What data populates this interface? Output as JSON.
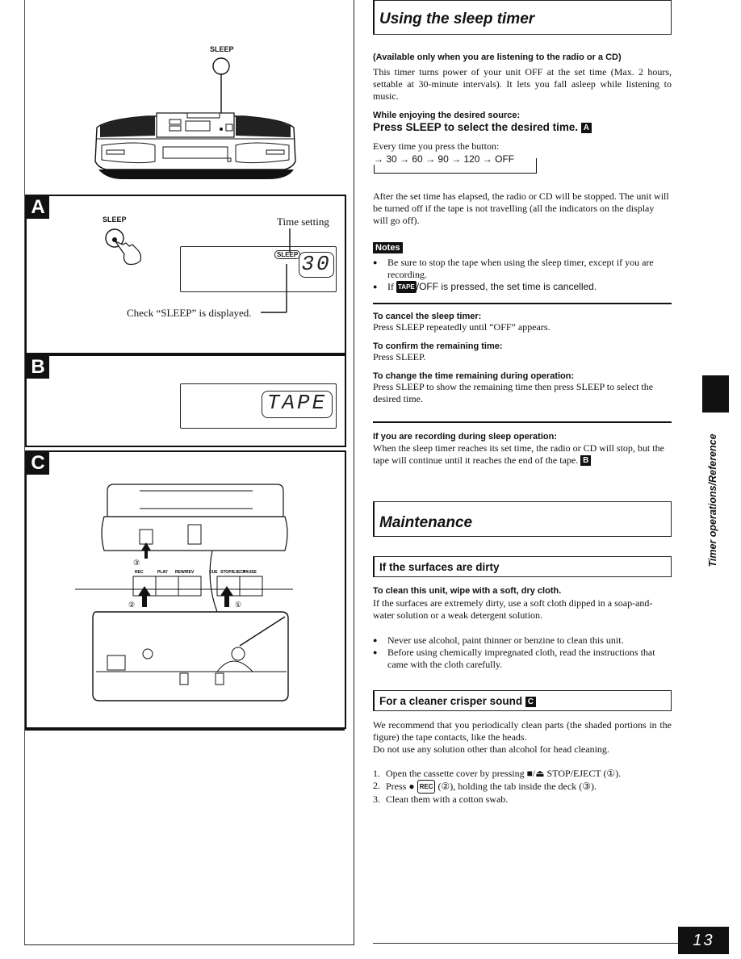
{
  "left": {
    "top_figure": {
      "button_label": "SLEEP"
    },
    "panel_a": {
      "letter": "A",
      "button_label": "SLEEP",
      "time_setting_label": "Time setting",
      "lcd_tag": "SLEEP",
      "lcd_digits": "30",
      "check_label": "Check “SLEEP” is displayed."
    },
    "panel_b": {
      "letter": "B",
      "lcd_text": "TAPE"
    },
    "panel_c": {
      "letter": "C",
      "button_labels": [
        "REC",
        "PLAY",
        "REW/REV",
        "CUE",
        "STOP/EJECT",
        "PAUSE"
      ],
      "callouts": [
        "①",
        "②",
        "③"
      ]
    }
  },
  "right": {
    "sleep_timer": {
      "title": "Using the sleep timer",
      "availability": "(Available only when you are listening to the radio or a CD)",
      "intro": "This timer turns power of your unit OFF at the set time (Max. 2 hours, settable at 30-minute intervals). It lets you fall asleep while listening to music.",
      "while_label": "While enjoying the desired source:",
      "instruction": "Press SLEEP to select the desired time.",
      "instruction_ref": "A",
      "every_time": "Every time you press the button:",
      "cycle": [
        "30",
        "60",
        "90",
        "120",
        "OFF"
      ],
      "after_text": "After the set time has elapsed, the radio or CD will be stopped. The unit will be turned off if the tape is not travelling (all the indicators on the display will go off).",
      "notes_label": "Notes",
      "notes": [
        {
          "text": "Be sure to stop the tape when using the sleep timer, except if you are recording."
        },
        {
          "prefix": "If",
          "badge": "TAPE",
          "text": "/OFF is pressed, the set time is cancelled."
        }
      ],
      "subsections": [
        {
          "heading": "To cancel the sleep timer:",
          "body": "Press SLEEP repeatedly until “OFF” appears."
        },
        {
          "heading": "To confirm the remaining time:",
          "body": "Press SLEEP."
        },
        {
          "heading": "To change the time remaining during operation:",
          "body": "Press SLEEP to show the remaining time then press SLEEP to select the desired time."
        }
      ],
      "recording": {
        "heading": "If you are recording during sleep operation:",
        "body": "When the sleep timer reaches its set time, the radio or CD will stop, but the tape will continue until it reaches the end of the tape.",
        "ref": "B"
      }
    },
    "maintenance": {
      "title": "Maintenance",
      "surfaces": {
        "title": "If the surfaces are dirty",
        "bold_line": "To clean this unit, wipe with a soft, dry cloth.",
        "body": "If the surfaces are extremely dirty, use a soft cloth dipped in a soap-and-water solution or a weak detergent solution.",
        "bullets": [
          "Never use alcohol, paint thinner or benzine to clean this unit.",
          "Before using chemically impregnated cloth, read the instructions that came with the cloth carefully."
        ]
      },
      "crisper": {
        "title": "For a cleaner crisper sound",
        "ref": "C",
        "body1": "We recommend that you periodically clean parts (the shaded portions in the figure) the tape contacts, like the heads.",
        "body2": "Do not use any solution other than alcohol for head cleaning.",
        "steps": [
          {
            "num": "1.",
            "pre": "Open the cassette cover by pressing ■/⏏ STOP/EJECT (①)."
          },
          {
            "num": "2.",
            "pre": "Press ●",
            "badge": "REC",
            "post": "(②), holding the tab inside the deck (③)."
          },
          {
            "num": "3.",
            "pre": "Clean them with a cotton swab."
          }
        ]
      }
    }
  },
  "side_tab": {
    "label": "Timer operations/Reference"
  },
  "page_number": "13"
}
